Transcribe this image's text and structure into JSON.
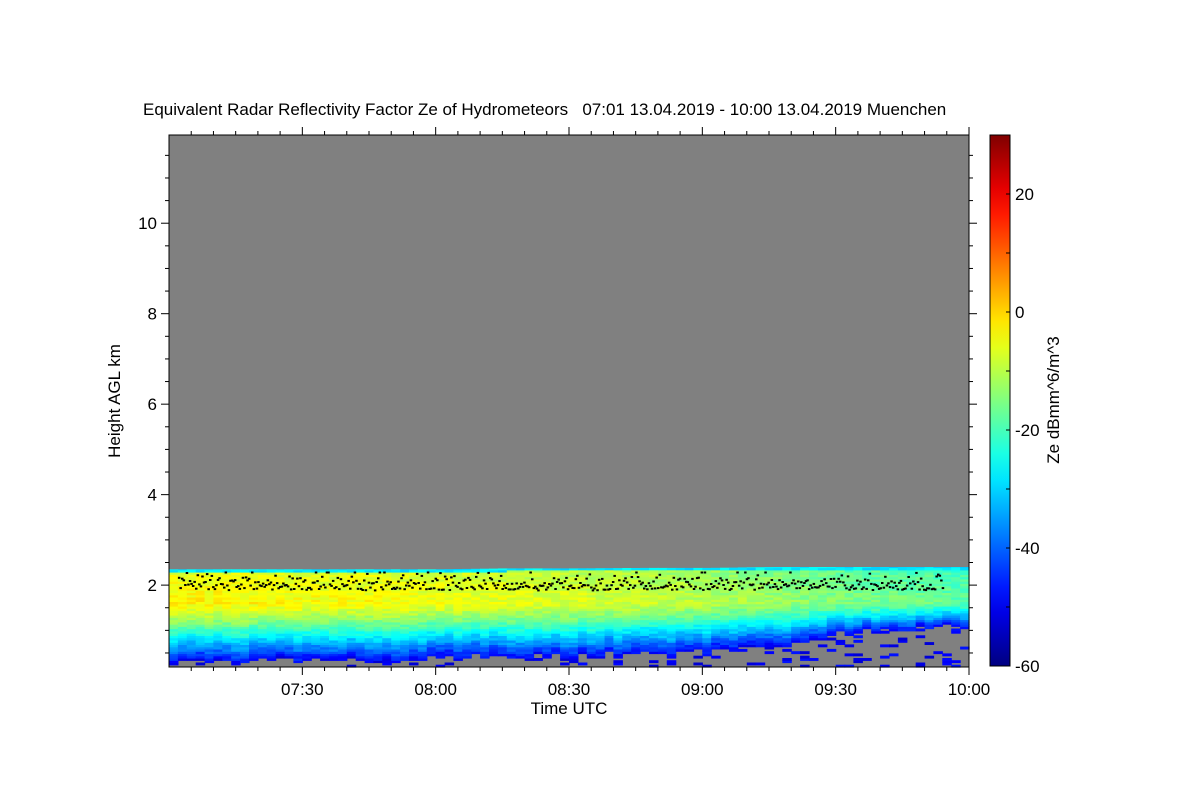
{
  "chart_data": {
    "type": "heatmap",
    "title": "Equivalent Radar Reflectivity Factor Ze of Hydrometeors   07:01 13.04.2019 - 10:00 13.04.2019 Muenchen",
    "xlabel": "Time UTC",
    "ylabel": "Height AGL km",
    "colorbar_label": "Ze dBmm^6/m^3",
    "xlim": [
      "07:00",
      "10:00"
    ],
    "ylim": [
      0.19,
      11.95
    ],
    "clim": [
      -60,
      30
    ],
    "colormap": "jet",
    "missing_color": "#808080",
    "x_ticks": [
      "07:30",
      "08:00",
      "08:30",
      "09:00",
      "09:30",
      "10:00"
    ],
    "y_ticks": [
      "2",
      "4",
      "6",
      "8",
      "10"
    ],
    "colorbar_ticks": [
      "20",
      "0",
      "-20",
      "-40",
      "-60"
    ],
    "profile_times": [
      "07:00",
      "07:15",
      "07:30",
      "07:45",
      "08:00",
      "08:15",
      "08:30",
      "08:45",
      "09:00",
      "09:15",
      "09:30",
      "09:45",
      "10:00"
    ],
    "echo_top_km": [
      2.35,
      2.35,
      2.35,
      2.35,
      2.35,
      2.37,
      2.37,
      2.38,
      2.38,
      2.4,
      2.4,
      2.4,
      2.4
    ],
    "echo_base_km": [
      0.3,
      0.3,
      0.35,
      0.3,
      0.35,
      0.4,
      0.4,
      0.45,
      0.5,
      0.6,
      0.9,
      1.0,
      1.1
    ],
    "peak_ze_dbz": [
      -3,
      -3,
      -4,
      -4,
      -5,
      -6,
      -7,
      -8,
      -10,
      -12,
      -15,
      -16,
      -18
    ],
    "marker_layer_km": [
      1.75,
      2.3
    ],
    "marker_color": "#000000"
  }
}
